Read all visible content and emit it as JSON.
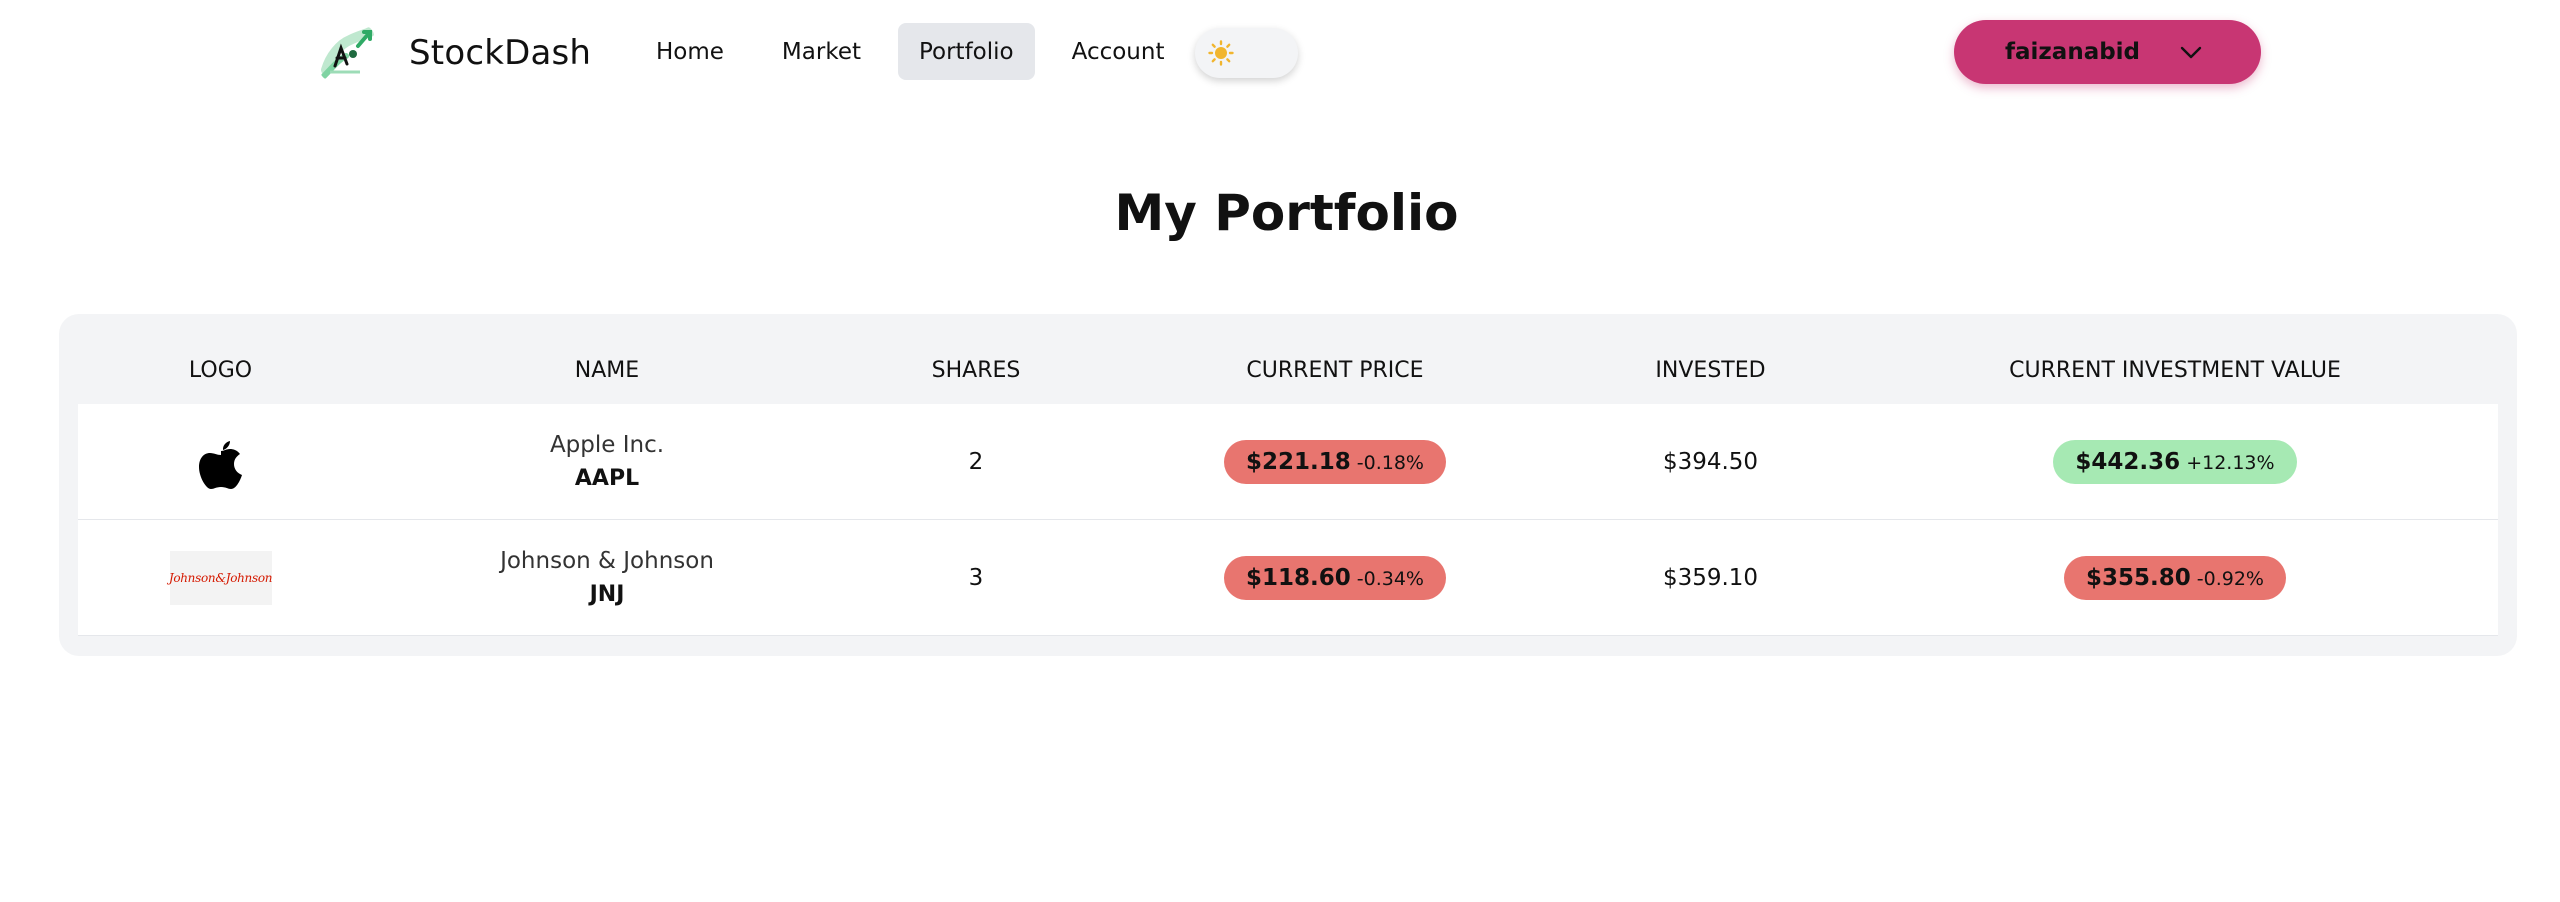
{
  "app": {
    "name": "StockDash"
  },
  "nav": {
    "items": [
      {
        "label": "Home",
        "active": false
      },
      {
        "label": "Market",
        "active": false
      },
      {
        "label": "Portfolio",
        "active": true
      },
      {
        "label": "Account",
        "active": false
      }
    ]
  },
  "user": {
    "name": "faizanabid"
  },
  "page": {
    "title": "My Portfolio"
  },
  "table": {
    "columns": [
      "LOGO",
      "NAME",
      "SHARES",
      "CURRENT PRICE",
      "INVESTED",
      "CURRENT INVESTMENT VALUE"
    ],
    "rows": [
      {
        "logo": "apple-logo",
        "name": "Apple Inc.",
        "symbol": "AAPL",
        "shares": "2",
        "price": "$221.18",
        "price_change": "-0.18%",
        "price_status": "down",
        "invested": "$394.50",
        "value": "$442.36",
        "value_change": "+12.13%",
        "value_status": "up"
      },
      {
        "logo": "johnson-and-johnson-logo",
        "logo_text": "Johnson&Johnson",
        "name": "Johnson & Johnson",
        "symbol": "JNJ",
        "shares": "3",
        "price": "$118.60",
        "price_change": "-0.34%",
        "price_status": "down",
        "invested": "$359.10",
        "value": "$355.80",
        "value_change": "-0.92%",
        "value_status": "down"
      }
    ]
  },
  "colors": {
    "up": "#a6e9b3",
    "down": "#e8756f",
    "accent": "#c83673",
    "nav_active": "#e5e7eb",
    "sun": "#f1b52e"
  }
}
